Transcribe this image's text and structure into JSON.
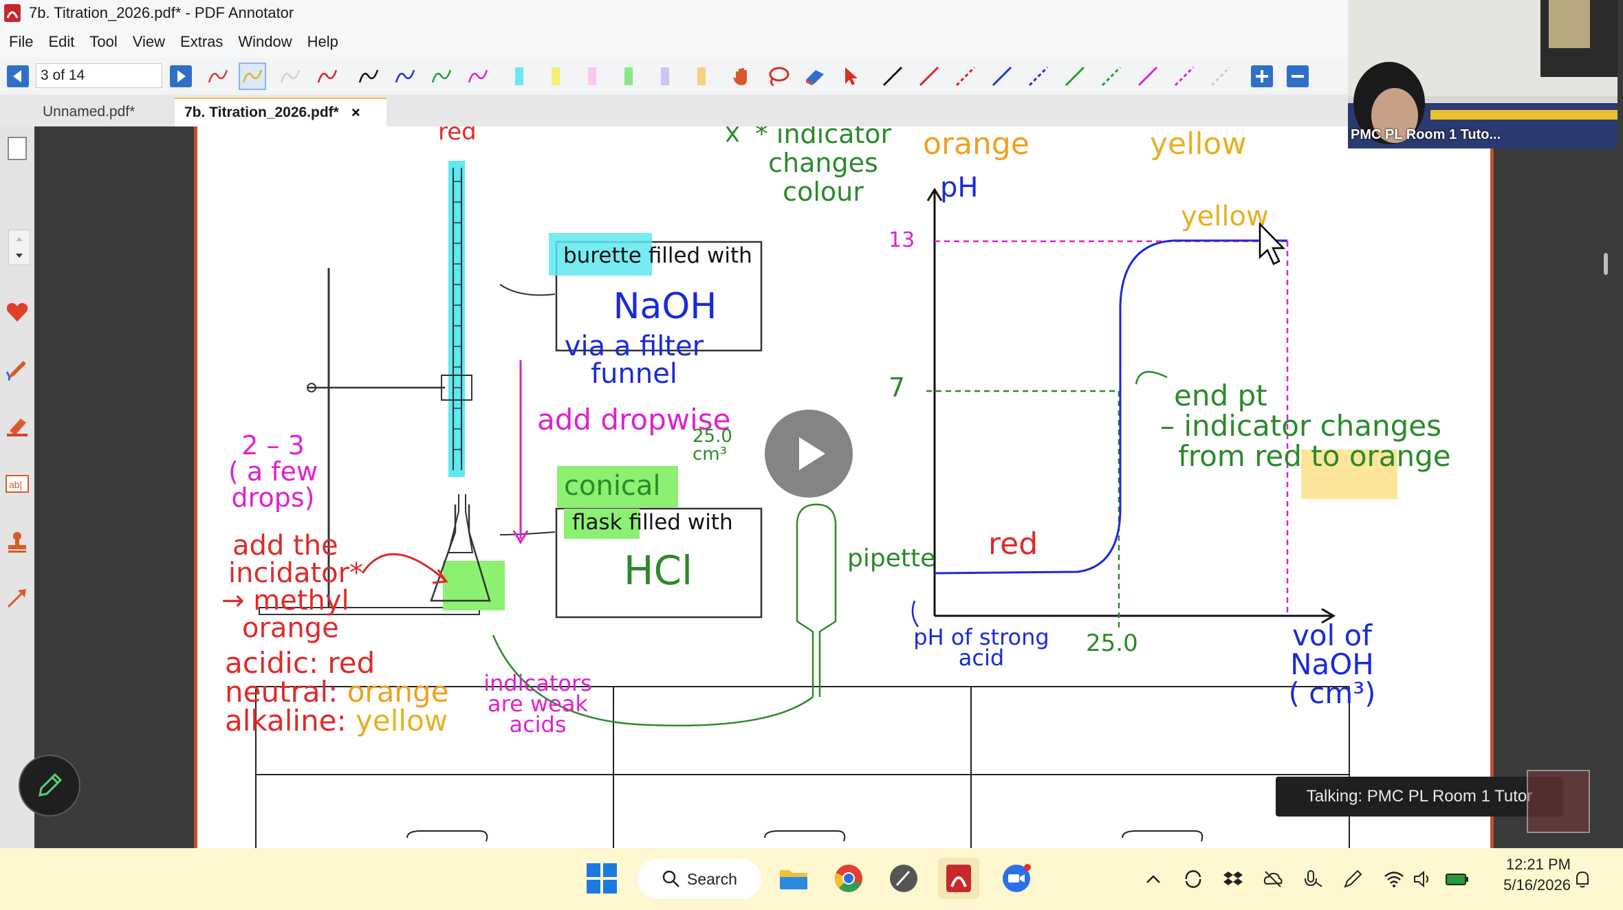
{
  "window": {
    "title": "7b. Titration_2026.pdf* - PDF Annotator"
  },
  "menu": {
    "items": [
      "File",
      "Edit",
      "Tool",
      "View",
      "Extras",
      "Window",
      "Help"
    ]
  },
  "toolbar": {
    "page_indicator": "3 of 14"
  },
  "tabs": [
    {
      "label": "Unnamed.pdf*",
      "active": false
    },
    {
      "label": "7b. Titration_2026.pdf*",
      "active": true,
      "close": "×"
    }
  ],
  "video": {
    "participant": "PMC PL Room 1 Tuto...",
    "talking": "Talking: PMC PL Room 1 Tutor"
  },
  "annotations": {
    "top_red": "red",
    "indicator_change": [
      "* indicator",
      "changes",
      "colour"
    ],
    "top_orange": "orange",
    "top_yellow": "yellow",
    "burette_box": [
      "burette filled with",
      "NaOH"
    ],
    "via_filter": [
      "via a filter",
      "funnel"
    ],
    "add_dropwise": "add dropwise",
    "vol": [
      "25.0",
      "cm³"
    ],
    "few_drops": [
      "2 – 3",
      "( a few",
      "drops)"
    ],
    "conical": "conical",
    "flask_box": [
      "flask filled with",
      "HCl"
    ],
    "add_indicator": [
      "add the",
      "incidator*",
      "→ methyl",
      "orange"
    ],
    "acidic": [
      "acidic: ",
      "red"
    ],
    "neutral": [
      "neutral: ",
      "orange"
    ],
    "alkaline": [
      "alkaline: ",
      "yellow"
    ],
    "weak_acids": [
      "indicators",
      "are weak",
      "acids"
    ],
    "pipette": "pipette",
    "graph_ph": "pH",
    "graph_13": "13",
    "graph_7": "7",
    "graph_yellow": "yellow",
    "graph_red": "red",
    "end_pt": [
      "end pt",
      "– indicator changes",
      "from red to ",
      "orange"
    ],
    "ph_strong": [
      "pH of strong",
      "acid"
    ],
    "graph_25": "25.0",
    "vol_naoh": [
      "vol of",
      "NaOH",
      "( cm³)"
    ]
  },
  "taskbar": {
    "search": "Search",
    "time": "12:21 PM",
    "date": "5/16/2026"
  },
  "colors": {
    "red_ink": "#e02a2a",
    "orange_ink": "#f0a020",
    "yellow_ink": "#e8b020",
    "blue_ink": "#1a2ad8",
    "green_ink": "#2a8a2a",
    "magenta_ink": "#e020d0",
    "cyan_hl": "#5ee8f0",
    "green_hl": "#8cf070",
    "orange_hl": "#fde59a"
  }
}
